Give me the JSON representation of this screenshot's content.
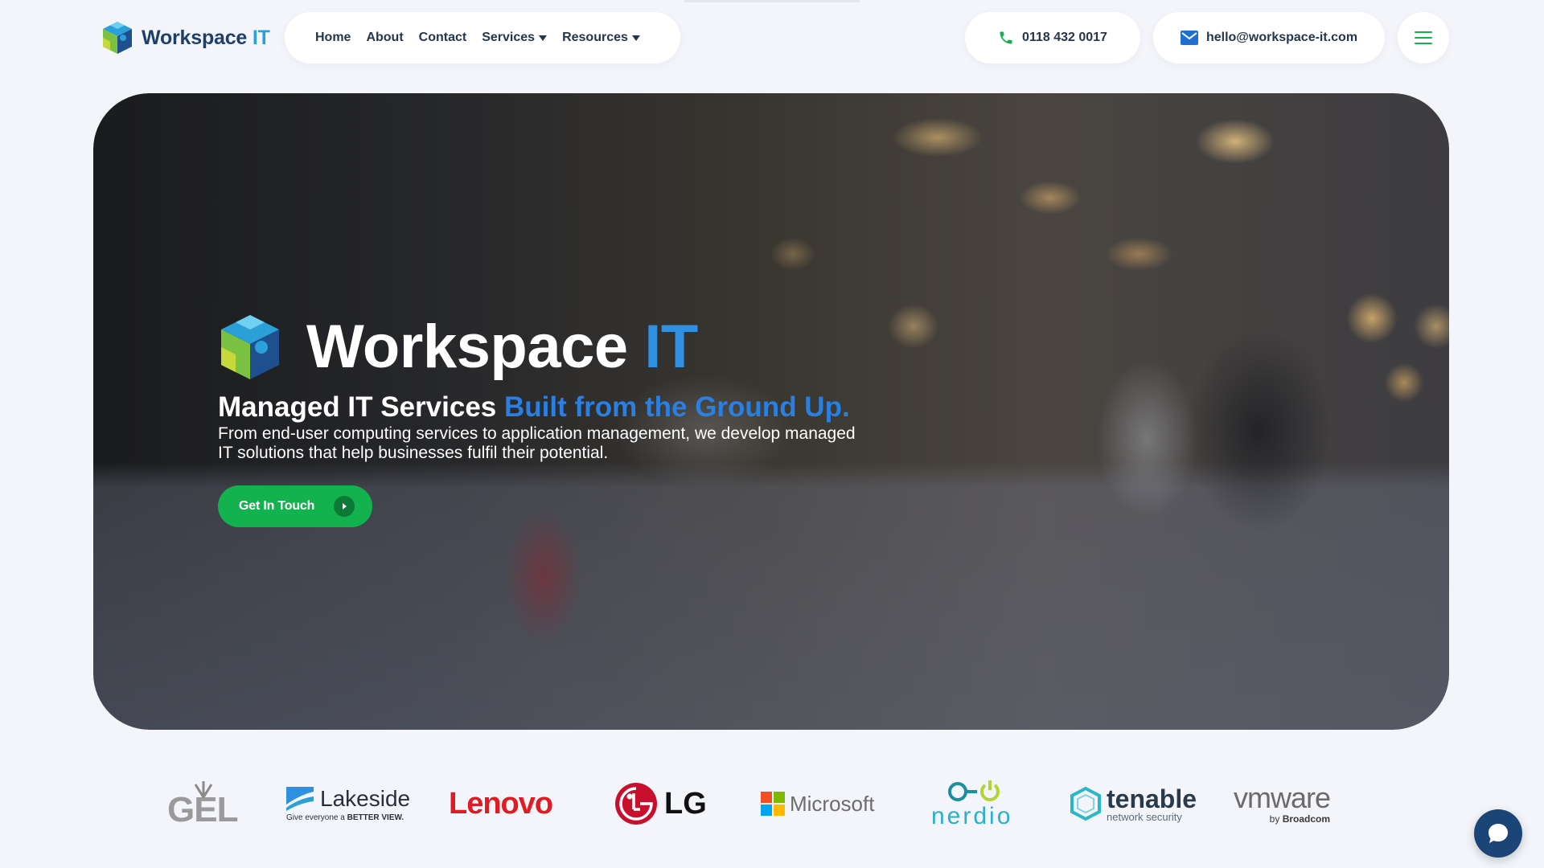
{
  "header": {
    "logo_word": "Workspace",
    "logo_accent": "IT",
    "nav": [
      {
        "label": "Home"
      },
      {
        "label": "About"
      },
      {
        "label": "Contact"
      },
      {
        "label": "Services"
      },
      {
        "label": "Resources"
      }
    ],
    "phone": "0118 432 0017",
    "email": "hello@workspace-it.com"
  },
  "hero": {
    "brand_word": "Workspace",
    "brand_accent": "IT",
    "title": "Managed IT Services",
    "title_accent": "Built from the Ground Up.",
    "description": "From end-user computing services to application management, we develop managed IT solutions that help businesses fulfil their potential.",
    "cta_label": "Get In Touch"
  },
  "partners": {
    "gel": "GEL",
    "lakeside": "Lakeside",
    "lakeside_tag_a": "Give everyone a",
    "lakeside_tag_b": "BETTER VIEW.",
    "lenovo": "Lenovo",
    "lg": "LG",
    "microsoft": "Microsoft",
    "nerdio": "nerdio",
    "tenable": "tenable",
    "tenable_tag": "network security",
    "vmware": "vmware",
    "vmware_tag_a": "by",
    "vmware_tag_b": "Broadcom"
  },
  "colors": {
    "brand_navy": "#1f3f6b",
    "brand_blue": "#2a9fd8",
    "cta_green": "#13b24f",
    "chat_navy": "#1b4577"
  },
  "icons": [
    "logo-cube-icon",
    "phone-icon",
    "mail-icon",
    "hamburger-menu-icon",
    "chevron-right-icon",
    "chat-bubble-icon"
  ]
}
